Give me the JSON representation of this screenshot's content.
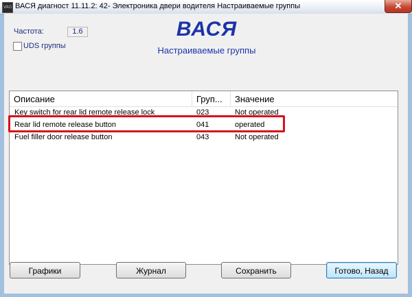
{
  "window": {
    "icon_text": "VAG",
    "title": "ВАСЯ диагност 11.11.2: 42- Электроника двери водителя   Настраиваемые группы",
    "close_symbol": "✕"
  },
  "params": {
    "freq_label": "Частота:",
    "freq_value": "1.6",
    "uds_label": "UDS группы"
  },
  "heading": {
    "title": "ВАСЯ",
    "subtitle": "Настраиваемые группы"
  },
  "table": {
    "columns": [
      "Описание",
      "Груп...",
      "Значение"
    ],
    "rows": [
      {
        "desc": "Key switch for rear lid remote release lock",
        "group": "023",
        "value": "Not operated"
      },
      {
        "desc": "Rear lid remote release button",
        "group": "041",
        "value": "operated"
      },
      {
        "desc": "Fuel filler door release button",
        "group": "043",
        "value": "Not operated"
      }
    ]
  },
  "buttons": {
    "graphs": "Графики",
    "journal": "Журнал",
    "save": "Сохранить",
    "done_back": "Готово, Назад"
  },
  "colors": {
    "accent": "#1c33a8",
    "highlight": "#d6121c"
  }
}
